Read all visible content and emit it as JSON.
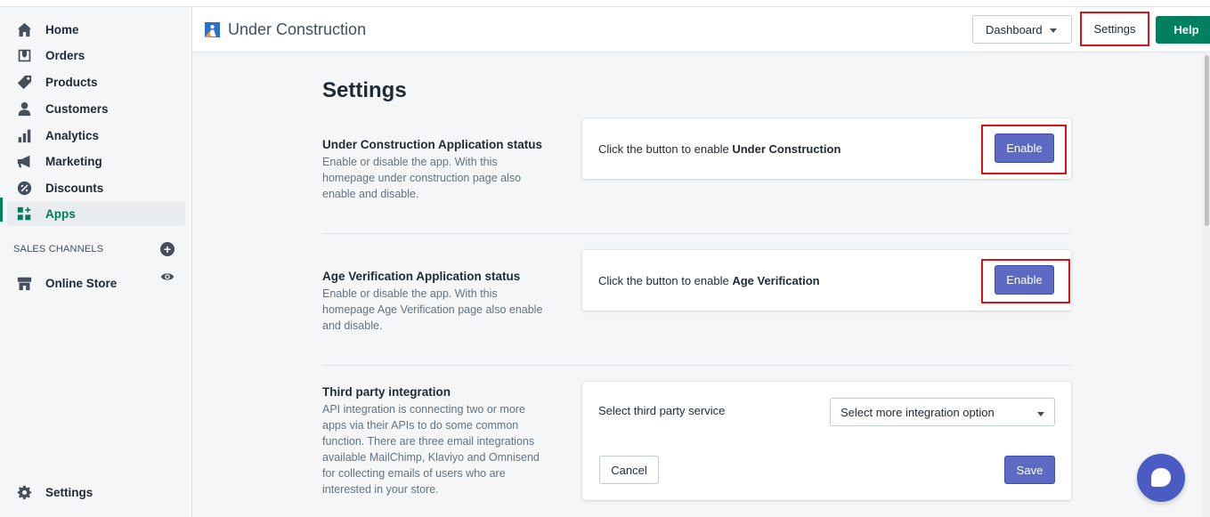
{
  "sidebar": {
    "items": [
      {
        "label": "Home",
        "icon": "home-icon"
      },
      {
        "label": "Orders",
        "icon": "orders-icon"
      },
      {
        "label": "Products",
        "icon": "tag-icon"
      },
      {
        "label": "Customers",
        "icon": "person-icon"
      },
      {
        "label": "Analytics",
        "icon": "bar-chart-icon"
      },
      {
        "label": "Marketing",
        "icon": "megaphone-icon"
      },
      {
        "label": "Discounts",
        "icon": "discount-icon"
      },
      {
        "label": "Apps",
        "icon": "apps-icon",
        "active": true
      }
    ],
    "sales_channels_title": "SALES CHANNELS",
    "online_store": "Online Store",
    "settings": "Settings"
  },
  "topbar": {
    "app_title": "Under Construction",
    "dashboard_label": "Dashboard",
    "settings_label": "Settings",
    "help_label": "Help"
  },
  "main": {
    "page_title": "Settings",
    "sections": [
      {
        "heading": "Under Construction Application status",
        "description": "Enable or disable the app. With this homepage under construction page also enable and disable.",
        "card_prefix": "Click the button to enable ",
        "card_bold": "Under Construction",
        "button": "Enable"
      },
      {
        "heading": "Age Verification Application status",
        "description": "Enable or disable the app. With this homepage Age Verification page also enable and disable.",
        "card_prefix": "Click the button to enable ",
        "card_bold": "Age Verification",
        "button": "Enable"
      },
      {
        "heading": "Third party integration",
        "description": "API integration is connecting two or more apps via their APIs to do some common function. There are three email integrations available MailChimp, Klaviyo and Omnisend for collecting emails of users who are interested in your store.",
        "select_label": "Select third party service",
        "select_value": "Select more integration option",
        "cancel": "Cancel",
        "save": "Save"
      }
    ]
  },
  "colors": {
    "accent": "#5c6ac4",
    "help_green": "#008060",
    "highlight_red": "#e0101a"
  }
}
